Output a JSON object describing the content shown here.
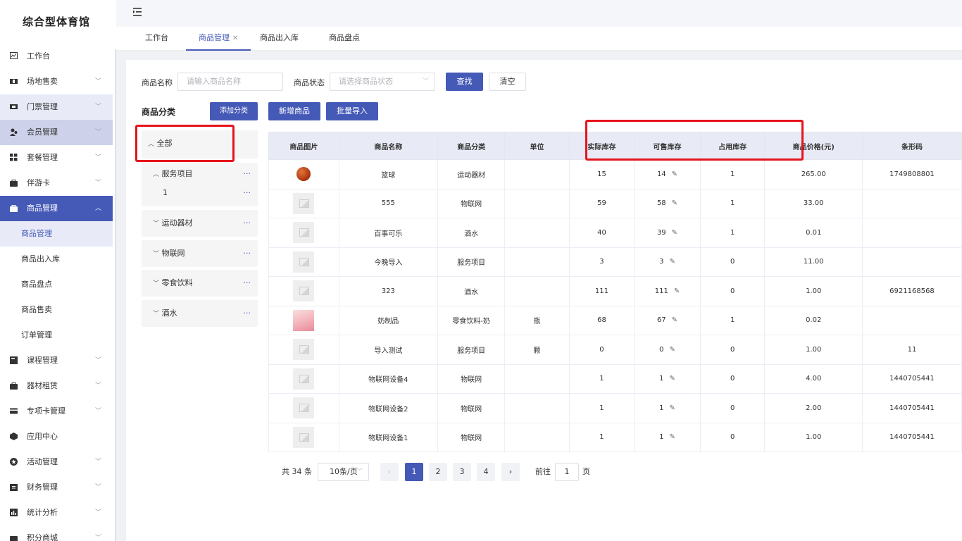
{
  "app": {
    "title": "综合型体育馆"
  },
  "sidebar": {
    "items": [
      {
        "label": "工作台"
      },
      {
        "label": "场地售卖"
      },
      {
        "label": "门票管理"
      },
      {
        "label": "会员管理"
      },
      {
        "label": "套餐管理"
      },
      {
        "label": "伴游卡"
      },
      {
        "label": "商品管理"
      },
      {
        "label": "课程管理"
      },
      {
        "label": "器材租赁"
      },
      {
        "label": "专项卡管理"
      },
      {
        "label": "应用中心"
      },
      {
        "label": "活动管理"
      },
      {
        "label": "财务管理"
      },
      {
        "label": "统计分析"
      },
      {
        "label": "积分商城"
      }
    ],
    "sub_items": [
      {
        "label": "商品管理"
      },
      {
        "label": "商品出入库"
      },
      {
        "label": "商品盘点"
      },
      {
        "label": "商品售卖"
      },
      {
        "label": "订单管理"
      }
    ]
  },
  "tabs": [
    {
      "label": "工作台"
    },
    {
      "label": "商品管理"
    },
    {
      "label": "商品出入库"
    },
    {
      "label": "商品盘点"
    }
  ],
  "filter": {
    "name_label": "商品名称",
    "name_placeholder": "请输入商品名称",
    "status_label": "商品状态",
    "status_placeholder": "请选择商品状态",
    "search_btn": "查找",
    "clear_btn": "清空"
  },
  "category": {
    "title": "商品分类",
    "add_btn": "添加分类",
    "all_label": "全部",
    "groups": [
      {
        "label": "服务项目",
        "children": [
          {
            "label": "1"
          }
        ]
      },
      {
        "label": "运动器材"
      },
      {
        "label": "物联网"
      },
      {
        "label": "零食饮料"
      },
      {
        "label": "酒水"
      }
    ]
  },
  "actions": {
    "new_btn": "新增商品",
    "import_btn": "批量导入"
  },
  "table": {
    "headers": [
      "商品图片",
      "商品名称",
      "商品分类",
      "单位",
      "实际库存",
      "可售库存",
      "占用库存",
      "商品价格(元)",
      "条形码"
    ],
    "rows": [
      {
        "img": "basketball",
        "name": "篮球",
        "category": "运动器材",
        "unit": "",
        "actual": "15",
        "sellable": "14",
        "occupied": "1",
        "price": "265.00",
        "barcode": "1749808801"
      },
      {
        "img": "placeholder",
        "name": "555",
        "category": "物联网",
        "unit": "",
        "actual": "59",
        "sellable": "58",
        "occupied": "1",
        "price": "33.00",
        "barcode": ""
      },
      {
        "img": "placeholder",
        "name": "百事可乐",
        "category": "酒水",
        "unit": "",
        "actual": "40",
        "sellable": "39",
        "occupied": "1",
        "price": "0.01",
        "barcode": ""
      },
      {
        "img": "placeholder",
        "name": "今晚导入",
        "category": "服务项目",
        "unit": "",
        "actual": "3",
        "sellable": "3",
        "occupied": "0",
        "price": "11.00",
        "barcode": ""
      },
      {
        "img": "placeholder",
        "name": "323",
        "category": "酒水",
        "unit": "",
        "actual": "111",
        "sellable": "111",
        "occupied": "0",
        "price": "1.00",
        "barcode": "6921168568"
      },
      {
        "img": "milk",
        "name": "奶制品",
        "category": "零食饮料-奶",
        "unit": "瓶",
        "actual": "68",
        "sellable": "67",
        "occupied": "1",
        "price": "0.02",
        "barcode": ""
      },
      {
        "img": "placeholder",
        "name": "导入测试",
        "category": "服务项目",
        "unit": "颗",
        "actual": "0",
        "sellable": "0",
        "occupied": "0",
        "price": "1.00",
        "barcode": "11"
      },
      {
        "img": "placeholder",
        "name": "物联网设备4",
        "category": "物联网",
        "unit": "",
        "actual": "1",
        "sellable": "1",
        "occupied": "0",
        "price": "4.00",
        "barcode": "1440705441"
      },
      {
        "img": "placeholder",
        "name": "物联网设备2",
        "category": "物联网",
        "unit": "",
        "actual": "1",
        "sellable": "1",
        "occupied": "0",
        "price": "2.00",
        "barcode": "1440705441"
      },
      {
        "img": "placeholder",
        "name": "物联网设备1",
        "category": "物联网",
        "unit": "",
        "actual": "1",
        "sellable": "1",
        "occupied": "0",
        "price": "1.00",
        "barcode": "1440705441"
      }
    ]
  },
  "pagination": {
    "total": "共 34 条",
    "page_size": "10条/页",
    "pages": [
      "1",
      "2",
      "3",
      "4"
    ],
    "goto_label": "前往",
    "goto_value": "1",
    "page_suffix": "页"
  },
  "colors": {
    "accent": "#4559b7",
    "highlight": "#e5141b"
  }
}
